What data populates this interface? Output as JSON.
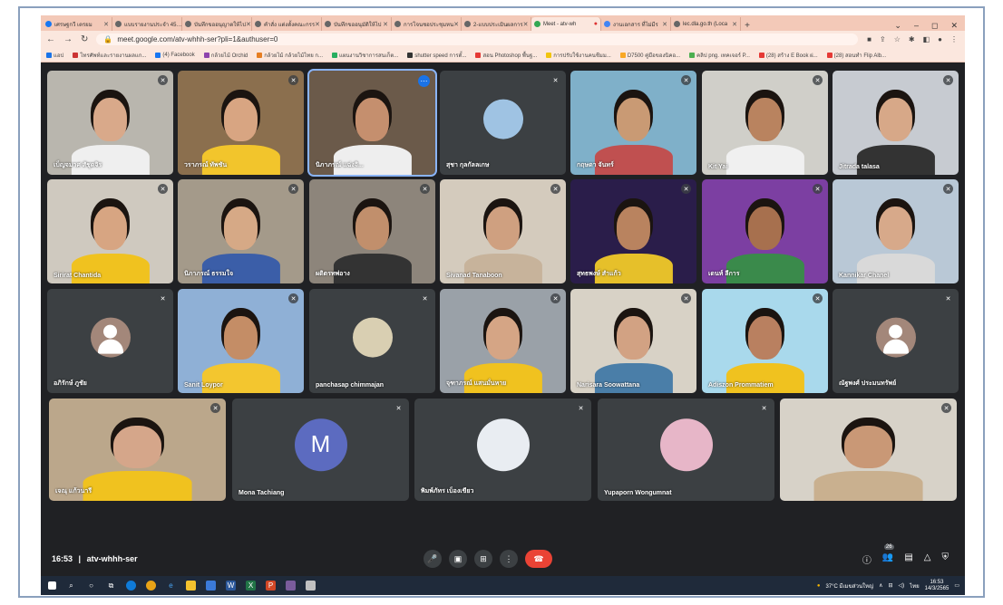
{
  "browser": {
    "tabs": [
      {
        "label": "เศรษฐกวี เตรยม"
      },
      {
        "label": "แบบรายงานประจำ 45…"
      },
      {
        "label": "บันทึกขออนุญาตให้ไป"
      },
      {
        "label": "คำสั่ง แต่งตั้งคณะกรร"
      },
      {
        "label": "บันทึกขออนุมัติให้ไป"
      },
      {
        "label": "การโจนชอประชุมหน"
      },
      {
        "label": "2-แบบประเมินผลการ"
      },
      {
        "label": "Meet - atv-wh",
        "active": true
      },
      {
        "label": "งานเอกสาร ที่ไม่มีร"
      },
      {
        "label": "lec.dla.go.th (Loca"
      }
    ],
    "new_tab": "+",
    "window_controls": [
      "⌄",
      "–",
      "◻",
      "✕"
    ],
    "url": "meet.google.com/atv-whhh-ser?pli=1&authuser=0",
    "bookmarks": [
      "แอป",
      "โทรศัพท์และรายงานผลแก...",
      "(4) Facebook",
      "กล้วยไม้ Orchid",
      "กล้วยไม้ กล้วยไม้ไทย ก...",
      "แผนงานวิชาการสนเก็ต...",
      "shutter speed การตั้...",
      "สอน Photoshop พื้นฐ...",
      "การปรับใช้งานคนชีมม...",
      "D7500 คู่มือของนิคอ...",
      "คลิป png. เทคเจอร์ P...",
      "(28) สร้าง E Book ผ่...",
      "(28) สอนทำ Flip Alb..."
    ]
  },
  "participants": [
    {
      "name": "เบ็ญจมาศ สัชุดจิร",
      "type": "video"
    },
    {
      "name": "วราภรณ์ ทัพชัน",
      "type": "video"
    },
    {
      "name": "นิภาภรณ์ แฉ่งจิ...",
      "type": "video",
      "active": true
    },
    {
      "name": "สุชา กุลกัลลเกษ",
      "type": "avatar"
    },
    {
      "name": "กฤษดา จันทร์",
      "type": "video"
    },
    {
      "name": "Kit Yai",
      "type": "video"
    },
    {
      "name": "Jitrada talasa",
      "type": "video"
    },
    {
      "name": "Sirirat Chantida",
      "type": "video"
    },
    {
      "name": "นิภาภรณ์ ธรรมใจ",
      "type": "video"
    },
    {
      "name": "ผดิตรทพ่อาง",
      "type": "video"
    },
    {
      "name": "Sivanad Tanaboon",
      "type": "video"
    },
    {
      "name": "สุทธพงษ์ สำแก้ว",
      "type": "video"
    },
    {
      "name": "เดนท์ ลีการ",
      "type": "video"
    },
    {
      "name": "Kannikar Chanel",
      "type": "video"
    },
    {
      "name": "อภิรักษ์ ภูชัย",
      "type": "avatar"
    },
    {
      "name": "Sanit Loypor",
      "type": "video"
    },
    {
      "name": "panchasap chimmajan",
      "type": "avatar"
    },
    {
      "name": "จุฑาภรณ์ แสนมั่นหาย",
      "type": "video"
    },
    {
      "name": "Narisara Soowattana",
      "type": "video"
    },
    {
      "name": "Adiszon Prommatiem",
      "type": "video"
    },
    {
      "name": "ณัฐพงศ์ ประมนทรัพย์",
      "type": "avatar"
    },
    {
      "name": "เจณุ แก้วนารี",
      "type": "video"
    },
    {
      "name": "Mona Tachiang",
      "type": "avatar",
      "letter": "M"
    },
    {
      "name": "พิมพ์ภัทร เบ็องเขียว",
      "type": "avatar"
    },
    {
      "name": "Yupaporn Wongumnat",
      "type": "avatar"
    },
    {
      "name": "",
      "type": "video"
    }
  ],
  "meeting": {
    "time": "16:53",
    "separator": "|",
    "code": "atv-whhh-ser",
    "participant_count": "26"
  },
  "taskbar": {
    "weather": "37°C มีเมฆส่วนใหญ่",
    "lang": "ไทย",
    "time": "16:53",
    "date": "14/3/2565"
  }
}
